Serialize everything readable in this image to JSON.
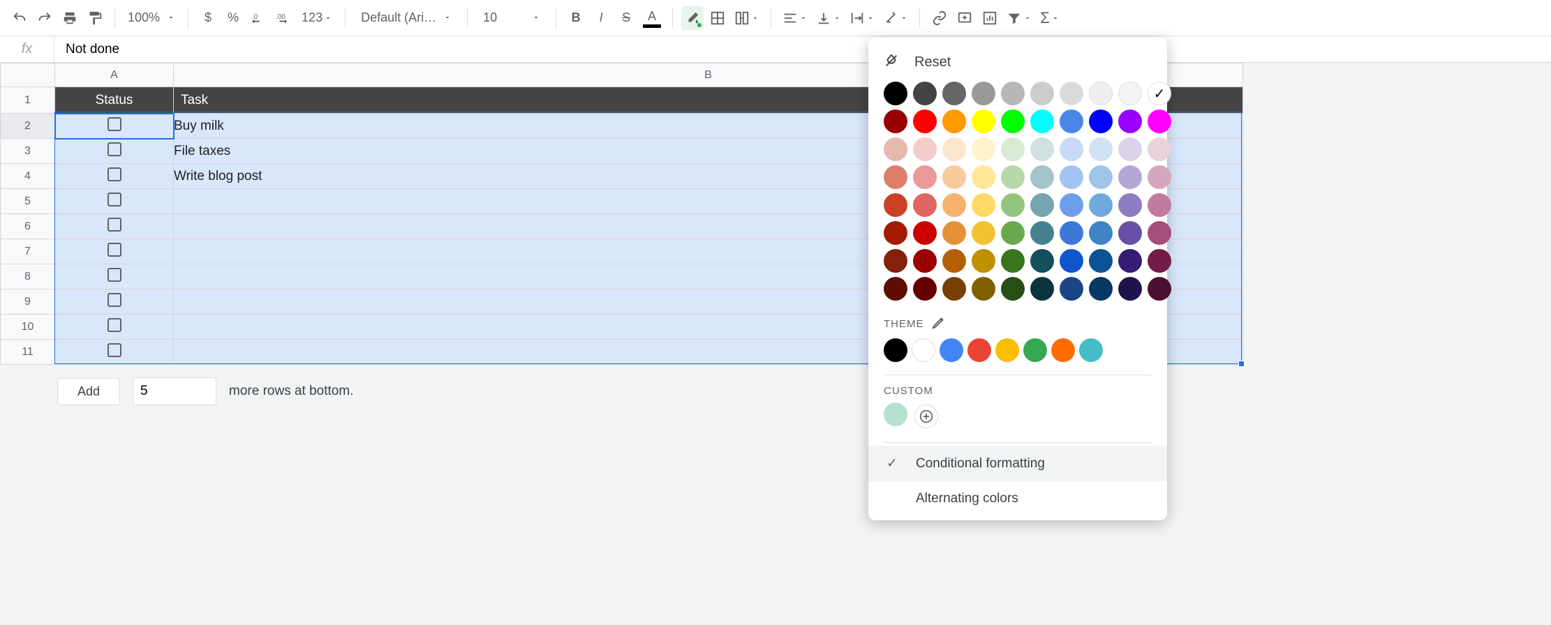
{
  "toolbar": {
    "zoom": "100%",
    "number_format": "123",
    "font": "Default (Ari…",
    "font_size": "10"
  },
  "formula_bar": {
    "fx": "fx",
    "value": "Not done"
  },
  "columns": [
    "A",
    "B"
  ],
  "row_numbers": [
    "1",
    "2",
    "3",
    "4",
    "5",
    "6",
    "7",
    "8",
    "9",
    "10",
    "11"
  ],
  "header": {
    "status": "Status",
    "task": "Task"
  },
  "rows": [
    {
      "task": "Buy milk"
    },
    {
      "task": "File taxes"
    },
    {
      "task": "Write blog post"
    },
    {
      "task": ""
    },
    {
      "task": ""
    },
    {
      "task": ""
    },
    {
      "task": ""
    },
    {
      "task": ""
    },
    {
      "task": ""
    },
    {
      "task": ""
    }
  ],
  "add_rows": {
    "button": "Add",
    "count": "5",
    "suffix": "more rows at bottom."
  },
  "color_popup": {
    "reset": "Reset",
    "theme_label": "THEME",
    "custom_label": "CUSTOM",
    "conditional": "Conditional formatting",
    "alternating": "Alternating colors",
    "main_grid": [
      [
        "#000000",
        "#434343",
        "#666666",
        "#999999",
        "#b7b7b7",
        "#cccccc",
        "#d9d9d9",
        "#efefef",
        "#f3f3f3",
        "#ffffff"
      ],
      [
        "#980000",
        "#ff0000",
        "#ff9900",
        "#ffff00",
        "#00ff00",
        "#00ffff",
        "#4a86e8",
        "#0000ff",
        "#9900ff",
        "#ff00ff"
      ],
      [
        "#e6b8af",
        "#f4cccc",
        "#fce5cd",
        "#fff2cc",
        "#d9ead3",
        "#d0e0e3",
        "#c9daf8",
        "#cfe2f3",
        "#d9d2e9",
        "#ead1dc"
      ],
      [
        "#dd7e6b",
        "#ea9999",
        "#f9cb9c",
        "#ffe599",
        "#b6d7a8",
        "#a2c4c9",
        "#a4c2f4",
        "#9fc5e8",
        "#b4a7d6",
        "#d5a6bd"
      ],
      [
        "#cc4125",
        "#e06666",
        "#f6b26b",
        "#ffd966",
        "#93c47d",
        "#76a5af",
        "#6d9eeb",
        "#6fa8dc",
        "#8e7cc3",
        "#c27ba0"
      ],
      [
        "#a61c00",
        "#cc0000",
        "#e69138",
        "#f1c232",
        "#6aa84f",
        "#45818e",
        "#3c78d8",
        "#3d85c6",
        "#674ea7",
        "#a64d79"
      ],
      [
        "#85200c",
        "#990000",
        "#b45f06",
        "#bf9000",
        "#38761d",
        "#134f5c",
        "#1155cc",
        "#0b5394",
        "#351c75",
        "#741b47"
      ],
      [
        "#5b0f00",
        "#660000",
        "#783f04",
        "#7f6000",
        "#274e13",
        "#0c343d",
        "#1c4587",
        "#073763",
        "#20124d",
        "#4c1130"
      ]
    ],
    "theme_colors": [
      "#000000",
      "#ffffff",
      "#4285f4",
      "#ea4335",
      "#fbbc04",
      "#34a853",
      "#ff6d01",
      "#46bdc6"
    ],
    "custom_colors": [
      "#b6e1cd"
    ]
  }
}
